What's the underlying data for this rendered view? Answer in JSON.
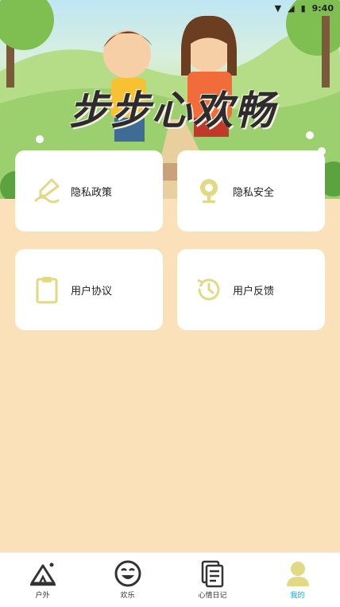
{
  "status_bar": {
    "time": "9:40"
  },
  "hero": {
    "title": "步步心欢畅"
  },
  "cards": [
    {
      "label": "隐私政策",
      "icon": "pen-icon"
    },
    {
      "label": "隐私安全",
      "icon": "location-pin-icon"
    },
    {
      "label": "用户协议",
      "icon": "clipboard-icon"
    },
    {
      "label": "用户反馈",
      "icon": "history-icon"
    }
  ],
  "tabs": [
    {
      "label": "户外",
      "icon": "tent-icon",
      "active": false
    },
    {
      "label": "欢乐",
      "icon": "smile-icon",
      "active": false
    },
    {
      "label": "心情日记",
      "icon": "document-icon",
      "active": false
    },
    {
      "label": "我的",
      "icon": "user-icon",
      "active": true
    }
  ],
  "colors": {
    "background": "#fae1b9",
    "icon_accent": "#e2d985",
    "active_tab": "#1fa0e0"
  }
}
